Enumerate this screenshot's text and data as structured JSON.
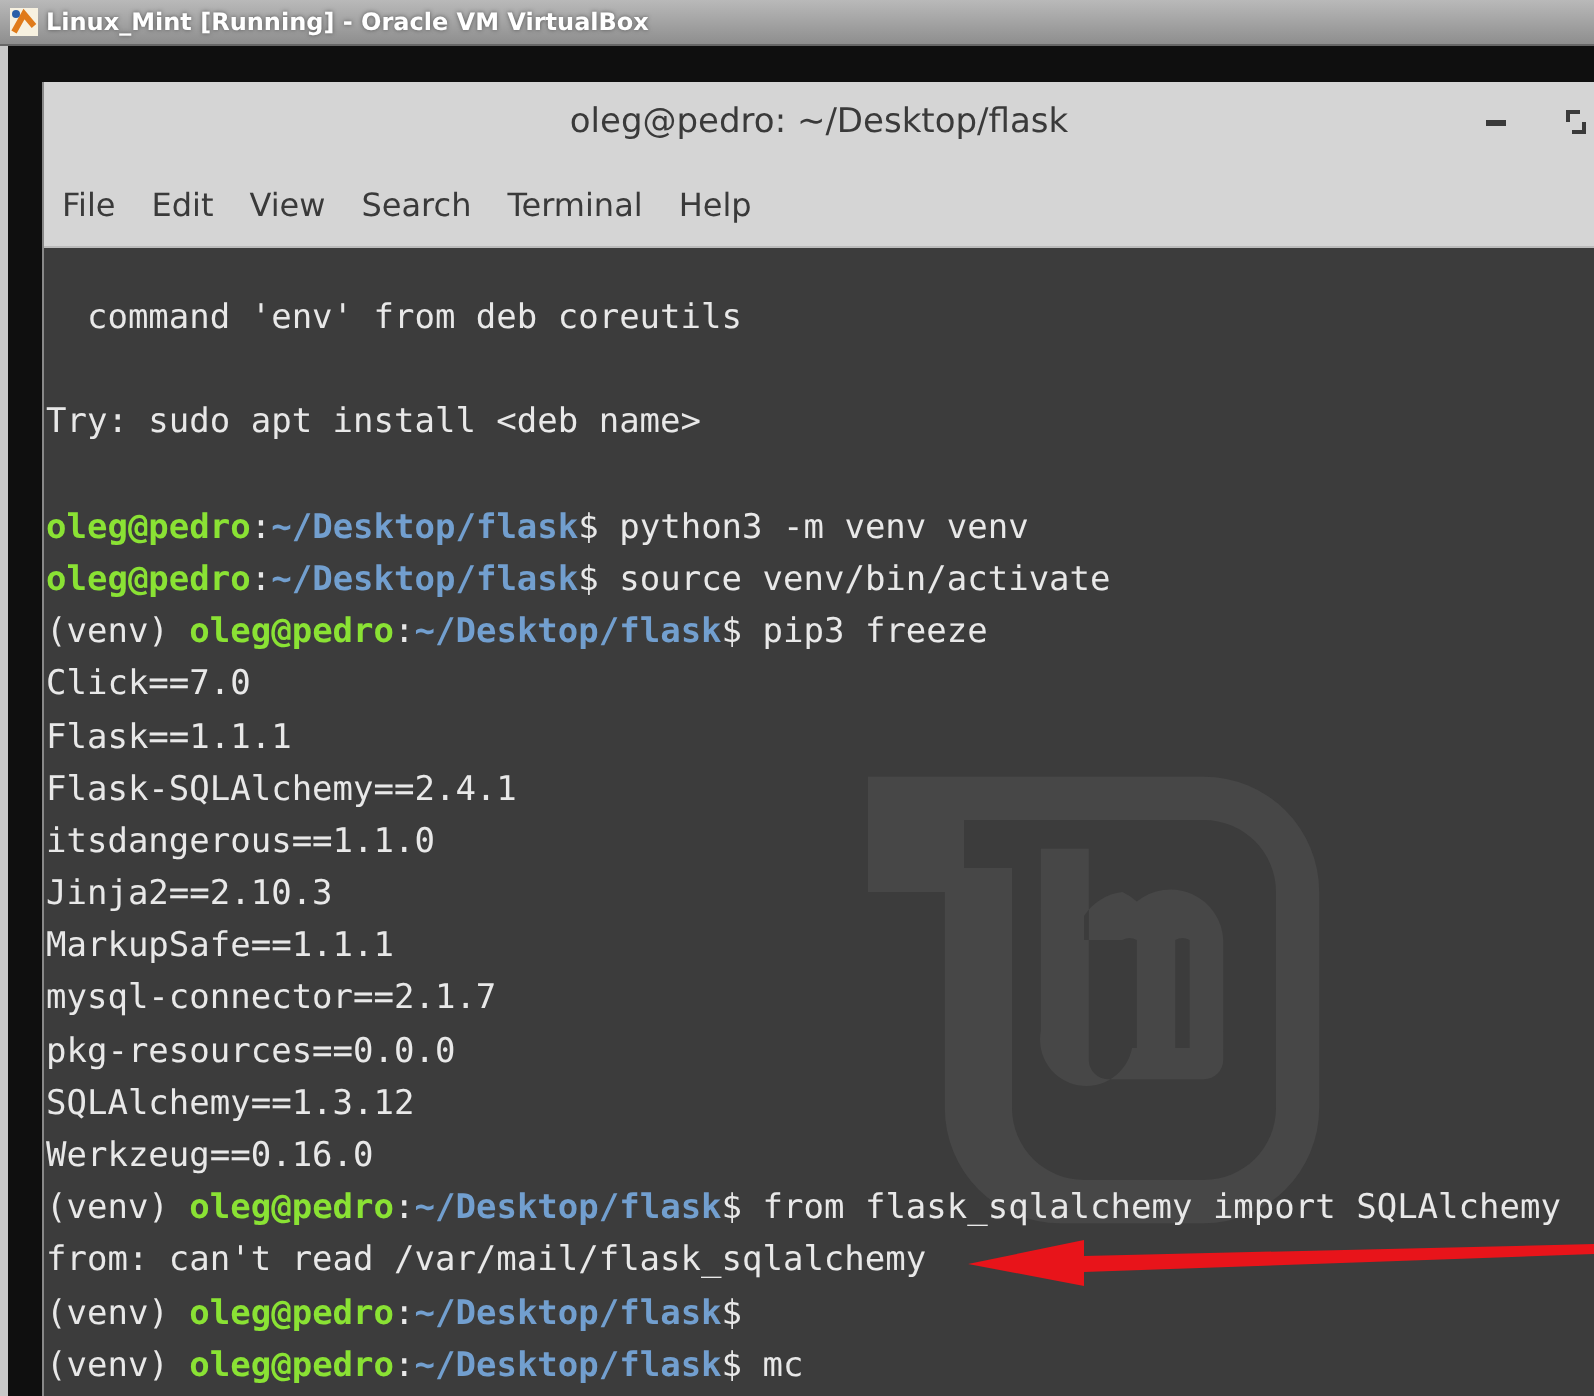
{
  "host_window": {
    "title": "Linux_Mint [Running] - Oracle VM VirtualBox"
  },
  "terminal": {
    "title": "oleg@pedro: ~/Desktop/flask",
    "menu": [
      "File",
      "Edit",
      "View",
      "Search",
      "Terminal",
      "Help"
    ],
    "lines": [
      {
        "kind": "output",
        "text": "  command 'env' from deb coreutils"
      },
      {
        "kind": "blank"
      },
      {
        "kind": "output",
        "text": "Try: sudo apt install <deb name>"
      },
      {
        "kind": "blank"
      },
      {
        "kind": "prompt",
        "user": "oleg@pedro",
        "sep": ":",
        "path": "~/Desktop/flask",
        "end": "$",
        "command": " python3 -m venv venv"
      },
      {
        "kind": "prompt",
        "user": "oleg@pedro",
        "sep": ":",
        "path": "~/Desktop/flask",
        "end": "$",
        "command": " source venv/bin/activate"
      },
      {
        "kind": "prompt",
        "env": "(venv) ",
        "user": "oleg@pedro",
        "sep": ":",
        "path": "~/Desktop/flask",
        "end": "$",
        "command": " pip3 freeze"
      },
      {
        "kind": "output",
        "text": "Click==7.0"
      },
      {
        "kind": "output",
        "text": "Flask==1.1.1"
      },
      {
        "kind": "output",
        "text": "Flask-SQLAlchemy==2.4.1"
      },
      {
        "kind": "output",
        "text": "itsdangerous==1.1.0"
      },
      {
        "kind": "output",
        "text": "Jinja2==2.10.3"
      },
      {
        "kind": "output",
        "text": "MarkupSafe==1.1.1"
      },
      {
        "kind": "output",
        "text": "mysql-connector==2.1.7"
      },
      {
        "kind": "output",
        "text": "pkg-resources==0.0.0"
      },
      {
        "kind": "output",
        "text": "SQLAlchemy==1.3.12"
      },
      {
        "kind": "output",
        "text": "Werkzeug==0.16.0"
      },
      {
        "kind": "prompt",
        "env": "(venv) ",
        "user": "oleg@pedro",
        "sep": ":",
        "path": "~/Desktop/flask",
        "end": "$",
        "command": " from flask_sqlalchemy import SQLAlchemy"
      },
      {
        "kind": "output",
        "text": "from: can't read /var/mail/flask_sqlalchemy"
      },
      {
        "kind": "prompt",
        "env": "(venv) ",
        "user": "oleg@pedro",
        "sep": ":",
        "path": "~/Desktop/flask",
        "end": "$"
      },
      {
        "kind": "prompt",
        "env": "(venv) ",
        "user": "oleg@pedro",
        "sep": ":",
        "path": "~/Desktop/flask",
        "end": "$",
        "command": " mc"
      }
    ]
  }
}
